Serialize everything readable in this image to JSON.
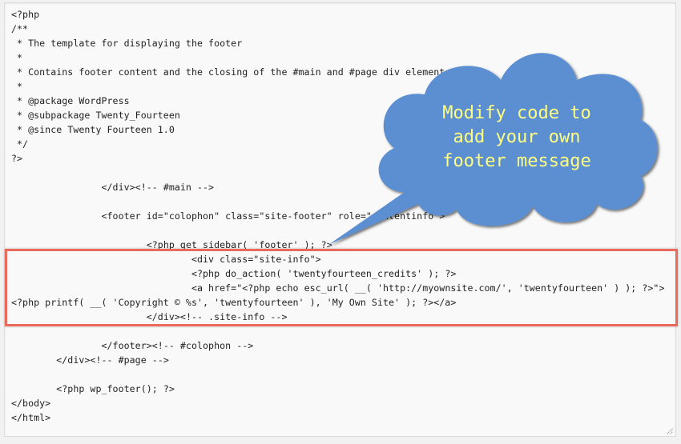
{
  "editor": {
    "lines": [
      "<?php",
      "/**",
      " * The template for displaying the footer",
      " *",
      " * Contains footer content and the closing of the #main and #page div elements",
      " *",
      " * @package WordPress",
      " * @subpackage Twenty_Fourteen",
      " * @since Twenty Fourteen 1.0",
      " */",
      "?>",
      "",
      "\t\t</div><!-- #main -->",
      "",
      "\t\t<footer id=\"colophon\" class=\"site-footer\" role=\"contentinfo\">",
      "",
      "\t\t\t<?php get_sidebar( 'footer' ); ?>",
      "\t\t\t\t<div class=\"site-info\">",
      "\t\t\t\t<?php do_action( 'twentyfourteen_credits' ); ?>",
      "\t\t\t\t<a href=\"<?php echo esc_url( __( 'http://myownsite.com/', 'twentyfourteen' ) ); ?>\">",
      "<?php printf( __( 'Copyright © %s', 'twentyfourteen' ), 'My Own Site' ); ?></a>",
      "\t\t\t</div><!-- .site-info -->",
      "",
      "\t\t</footer><!-- #colophon -->",
      "\t</div><!-- #page -->",
      "",
      "\t<?php wp_footer(); ?>",
      "</body>",
      "</html>"
    ],
    "highlighted_line_range": [
      18,
      22
    ]
  },
  "callout": {
    "lines": [
      "Modify code to",
      "add your own",
      "footer message"
    ],
    "fill_color": "#5b8fd2",
    "text_color": "#ffff80"
  },
  "highlight": {
    "border_color": "#ec6a5b"
  }
}
